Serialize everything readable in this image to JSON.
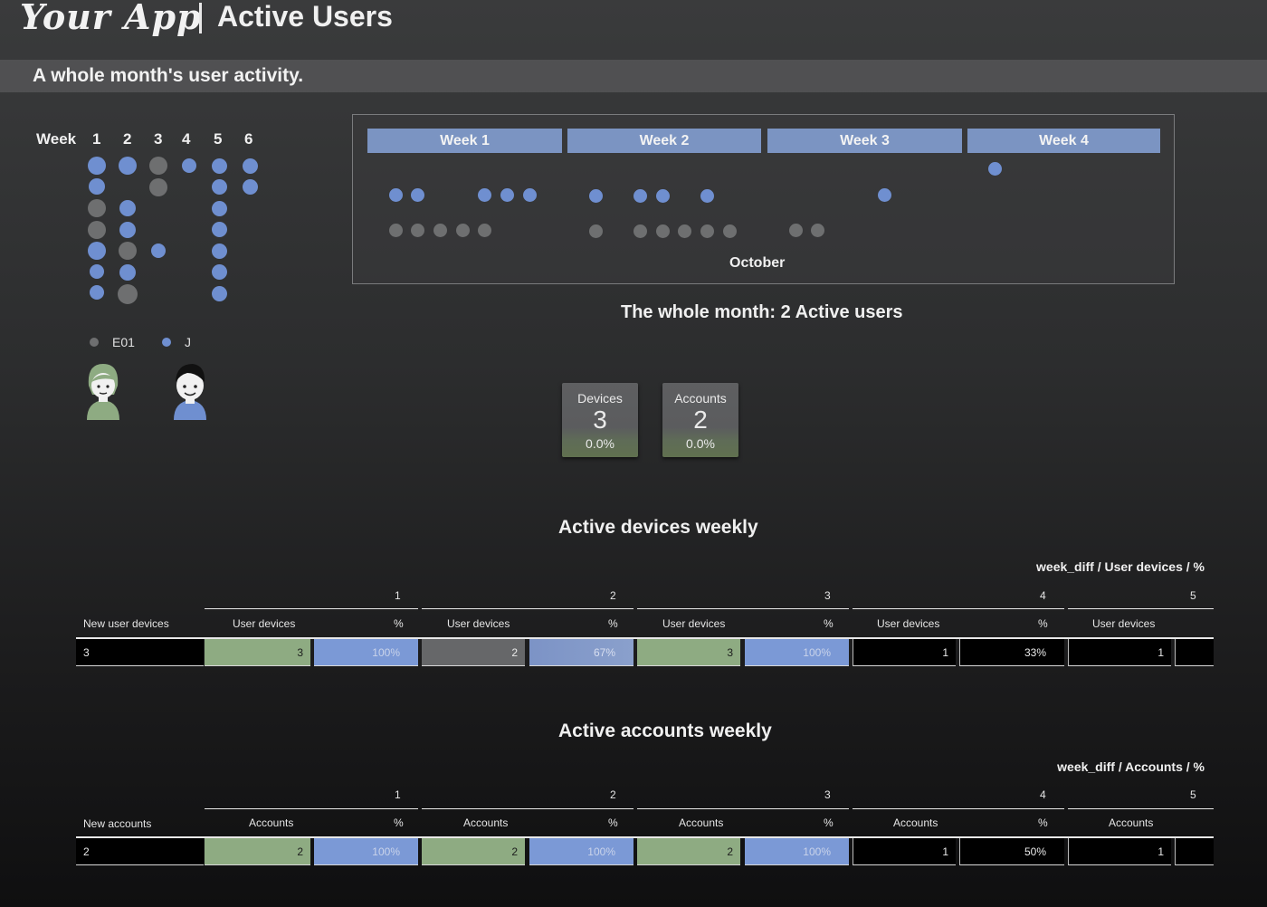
{
  "header": {
    "logo": "Your App",
    "title": "Active Users",
    "subtitle": "A whole month's user activity."
  },
  "week_matrix": {
    "label": "Week",
    "weeks": [
      "1",
      "2",
      "3",
      "4",
      "5",
      "6"
    ]
  },
  "legend": [
    {
      "name": "E01",
      "color": "#6e6f70"
    },
    {
      "name": "J",
      "color": "#6f8fd0"
    }
  ],
  "calendar": {
    "week_headers": [
      "Week 1",
      "Week 2",
      "Week 3",
      "Week 4"
    ],
    "month": "October"
  },
  "summary": "The whole month: 2 Active users",
  "kpis": [
    {
      "label": "Devices",
      "value": "3",
      "pct": "0.0%"
    },
    {
      "label": "Accounts",
      "value": "2",
      "pct": "0.0%"
    }
  ],
  "devices_table": {
    "title": "Active devices weekly",
    "pivot_header": "week_diff / User devices / %",
    "week_numbers": [
      "1",
      "2",
      "3",
      "4",
      "5"
    ],
    "row_header": "New user devices",
    "value_header": "User devices",
    "pct_header": "%",
    "new_value": "3",
    "values": [
      "3",
      "2",
      "3",
      "1",
      "1"
    ],
    "pcts": [
      "100%",
      "67%",
      "100%",
      "33%"
    ]
  },
  "accounts_table": {
    "title": "Active accounts weekly",
    "pivot_header": "week_diff / Accounts / %",
    "week_numbers": [
      "1",
      "2",
      "3",
      "4",
      "5"
    ],
    "row_header": "New accounts",
    "value_header": "Accounts",
    "pct_header": "%",
    "new_value": "2",
    "values": [
      "2",
      "2",
      "2",
      "1",
      "1"
    ],
    "pcts": [
      "100%",
      "100%",
      "100%",
      "50%"
    ]
  }
}
